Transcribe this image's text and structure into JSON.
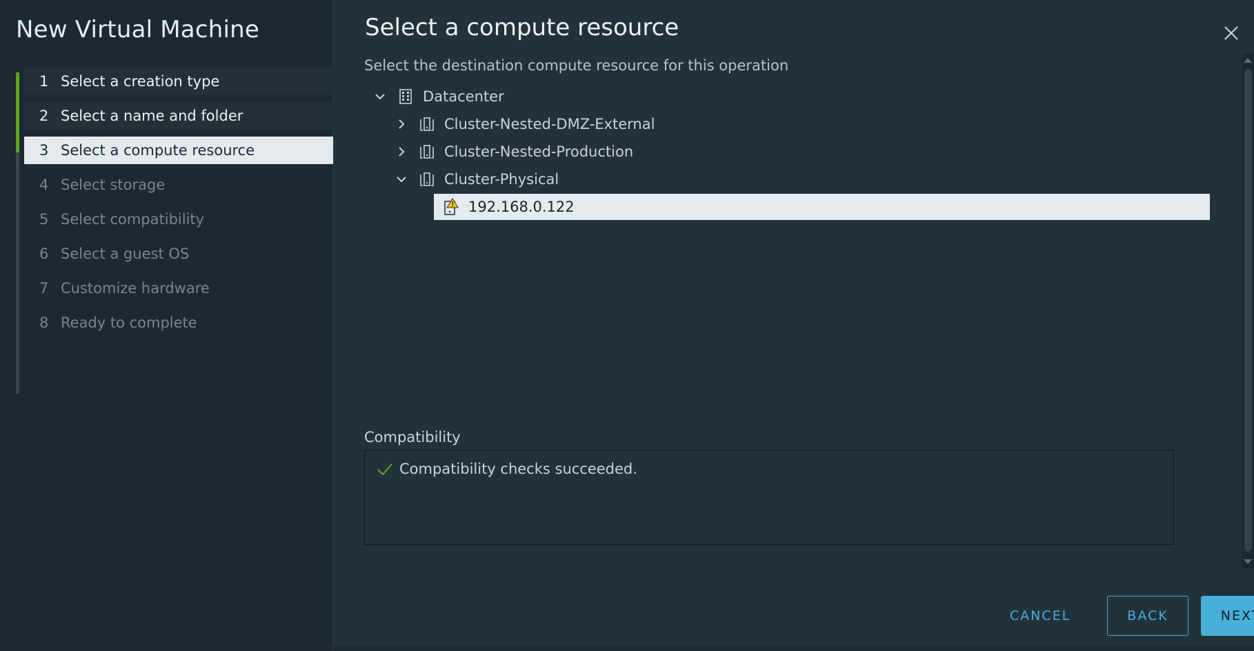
{
  "wizard": {
    "title": "New Virtual Machine",
    "steps": [
      {
        "number": "1",
        "label": "Select a creation type",
        "state": "done"
      },
      {
        "number": "2",
        "label": "Select a name and folder",
        "state": "done"
      },
      {
        "number": "3",
        "label": "Select a compute resource",
        "state": "current"
      },
      {
        "number": "4",
        "label": "Select storage",
        "state": "pending"
      },
      {
        "number": "5",
        "label": "Select compatibility",
        "state": "pending"
      },
      {
        "number": "6",
        "label": "Select a guest OS",
        "state": "pending"
      },
      {
        "number": "7",
        "label": "Customize hardware",
        "state": "pending"
      },
      {
        "number": "8",
        "label": "Ready to complete",
        "state": "pending"
      }
    ]
  },
  "main": {
    "title": "Select a compute resource",
    "subtitle": "Select the destination compute resource for this operation",
    "tree": [
      {
        "label": "Datacenter",
        "icon": "datacenter-icon",
        "expanded": true
      },
      {
        "label": "Cluster-Nested-DMZ-External",
        "icon": "cluster-icon",
        "expanded": false
      },
      {
        "label": "Cluster-Nested-Production",
        "icon": "cluster-icon",
        "expanded": false
      },
      {
        "label": "Cluster-Physical",
        "icon": "cluster-icon",
        "expanded": true
      },
      {
        "label": "192.168.0.122",
        "icon": "host-warning-icon",
        "selected": true
      }
    ],
    "compatibility": {
      "label": "Compatibility",
      "message": "Compatibility checks succeeded."
    }
  },
  "footer": {
    "cancel_label": "CANCEL",
    "back_label": "BACK",
    "next_label": "NEXT"
  },
  "colors": {
    "accent": "#49afd9",
    "progress": "#62a420",
    "success": "#62a420",
    "warning": "#f2c500"
  }
}
